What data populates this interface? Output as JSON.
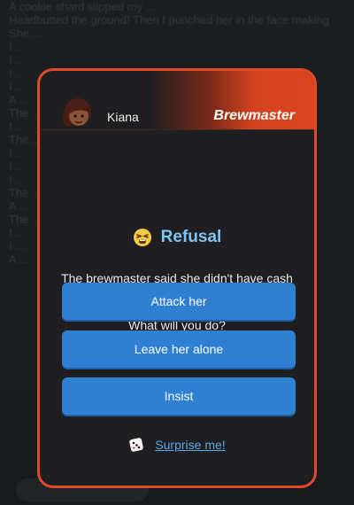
{
  "background": {
    "log_lines": [
      "A cookie shard slipped my ...",
      "Headbutted the ground! Then I punched her in the face making",
      "",
      "She ...",
      "",
      "I ...",
      "I ...",
      "I ...",
      "I ...",
      "A ...",
      "The ...",
      "I ...",
      "The ...",
      "I ...",
      "I ...",
      "I ...",
      "The ...",
      "A ...",
      "The ...",
      "I ...",
      "I ...",
      "A ..."
    ]
  },
  "modal": {
    "accent_color": "#e04a2a",
    "header": {
      "character_name": "Kiana",
      "role": "Brewmaster",
      "avatar": "person-avatar"
    },
    "event": {
      "icon": "tired-face-emoji",
      "title": "Refusal",
      "description": "The brewmaster said she didn't have cash to donate to your fake monastery.",
      "prompt": "What will you do?"
    },
    "options": [
      {
        "label": "Attack her"
      },
      {
        "label": "Leave her alone"
      },
      {
        "label": "Insist"
      }
    ],
    "surprise": {
      "icon": "dice-icon",
      "label": "Surprise me!"
    }
  }
}
